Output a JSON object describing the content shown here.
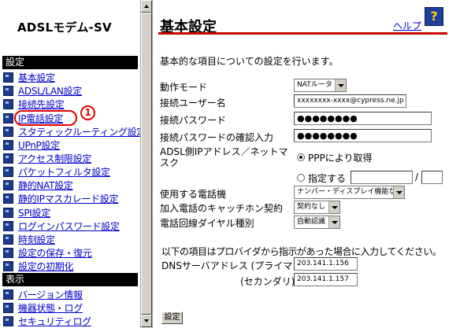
{
  "sidebar": {
    "logo": "ADSLモデム-SV",
    "section_settings": "設定",
    "settings_items": [
      {
        "label": "基本設定"
      },
      {
        "label": "ADSL/LAN設定"
      },
      {
        "label": "接続先設定"
      },
      {
        "label": "IP電話設定"
      },
      {
        "label": "スタティックルーティング設定"
      },
      {
        "label": "UPnP設定"
      },
      {
        "label": "アクセス制限設定"
      },
      {
        "label": "パケットフィルタ設定"
      },
      {
        "label": "静的NAT設定"
      },
      {
        "label": "静的IPマスカレード設定"
      },
      {
        "label": "SPI設定"
      },
      {
        "label": "ログインパスワード設定"
      },
      {
        "label": "時刻設定"
      },
      {
        "label": "設定の保存・復元"
      },
      {
        "label": "設定の初期化"
      }
    ],
    "section_display": "表示",
    "display_items": [
      {
        "label": "バージョン情報"
      },
      {
        "label": "機器状態・ログ"
      },
      {
        "label": "セキュリティログ"
      }
    ],
    "callout_number": "1",
    "colors": {
      "highlight": "#e00000",
      "link": "#0000cc",
      "section_bg": "#000000"
    }
  },
  "main": {
    "title": "基本設定",
    "help_label": "ヘルプ",
    "help_icon_glyph": "?",
    "intro": "基本的な項目についての設定を行います。",
    "operation_mode_label": "動作モード",
    "operation_mode_value": "NATルータ",
    "username_label": "接続ユーザー名",
    "username_value": "xxxxxxxx-xxxx@cypress.ne.jp",
    "password_label": "接続パスワード",
    "password_value": "●●●●●●●●",
    "password_confirm_label": "接続パスワードの確認入力",
    "password_confirm_value": "●●●●●●●●",
    "wan_ip_label": "ADSL側IPアドレス／ネットマスク",
    "wan_ip_option_ppp": "PPPにより取得",
    "wan_ip_option_manual": "指定する",
    "ip_mask_separator": "/",
    "phone_device_label": "使用する電話機",
    "phone_device_value": "ナンバー・ディスプレイ機能なし",
    "catch_phone_label": "加入電話のキャッチホン契約",
    "catch_phone_value": "契約なし",
    "dial_type_label": "電話回線ダイヤル種別",
    "dial_type_value": "自動認識",
    "dns_note": "以下の項目はプロバイダから指示があった場合に入力してください。",
    "dns_primary_label": "DNSサーバアドレス (プライマリ)",
    "dns_primary_value": "203.141.1.156",
    "dns_secondary_label": "(セカンダリ)",
    "dns_secondary_value": "203.141.1.157",
    "submit_label": "設定",
    "colors": {
      "title_rule": "#cc0000",
      "help_icon_bg": "#1f3f9c"
    }
  }
}
